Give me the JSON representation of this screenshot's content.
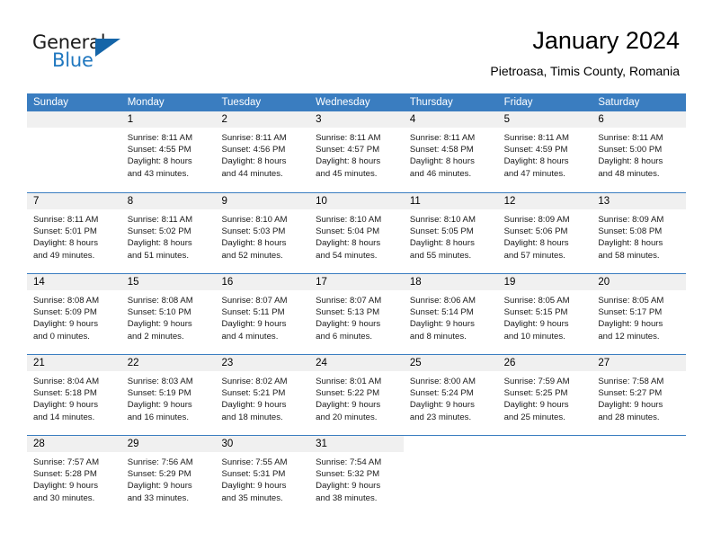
{
  "brand": {
    "name_part1": "General",
    "name_part2": "Blue"
  },
  "header": {
    "month_title": "January 2024",
    "location": "Pietroasa, Timis County, Romania"
  },
  "colors": {
    "header_bar": "#3a7dc0",
    "day_number_bg": "#f0f0f0",
    "brand_blue": "#1f77bf",
    "triangle_blue": "#1565a8"
  },
  "weekdays": [
    "Sunday",
    "Monday",
    "Tuesday",
    "Wednesday",
    "Thursday",
    "Friday",
    "Saturday"
  ],
  "weeks": [
    [
      {
        "day": "",
        "sunrise": "",
        "sunset": "",
        "daylight1": "",
        "daylight2": "",
        "empty": true
      },
      {
        "day": "1",
        "sunrise": "Sunrise: 8:11 AM",
        "sunset": "Sunset: 4:55 PM",
        "daylight1": "Daylight: 8 hours",
        "daylight2": "and 43 minutes."
      },
      {
        "day": "2",
        "sunrise": "Sunrise: 8:11 AM",
        "sunset": "Sunset: 4:56 PM",
        "daylight1": "Daylight: 8 hours",
        "daylight2": "and 44 minutes."
      },
      {
        "day": "3",
        "sunrise": "Sunrise: 8:11 AM",
        "sunset": "Sunset: 4:57 PM",
        "daylight1": "Daylight: 8 hours",
        "daylight2": "and 45 minutes."
      },
      {
        "day": "4",
        "sunrise": "Sunrise: 8:11 AM",
        "sunset": "Sunset: 4:58 PM",
        "daylight1": "Daylight: 8 hours",
        "daylight2": "and 46 minutes."
      },
      {
        "day": "5",
        "sunrise": "Sunrise: 8:11 AM",
        "sunset": "Sunset: 4:59 PM",
        "daylight1": "Daylight: 8 hours",
        "daylight2": "and 47 minutes."
      },
      {
        "day": "6",
        "sunrise": "Sunrise: 8:11 AM",
        "sunset": "Sunset: 5:00 PM",
        "daylight1": "Daylight: 8 hours",
        "daylight2": "and 48 minutes."
      }
    ],
    [
      {
        "day": "7",
        "sunrise": "Sunrise: 8:11 AM",
        "sunset": "Sunset: 5:01 PM",
        "daylight1": "Daylight: 8 hours",
        "daylight2": "and 49 minutes."
      },
      {
        "day": "8",
        "sunrise": "Sunrise: 8:11 AM",
        "sunset": "Sunset: 5:02 PM",
        "daylight1": "Daylight: 8 hours",
        "daylight2": "and 51 minutes."
      },
      {
        "day": "9",
        "sunrise": "Sunrise: 8:10 AM",
        "sunset": "Sunset: 5:03 PM",
        "daylight1": "Daylight: 8 hours",
        "daylight2": "and 52 minutes."
      },
      {
        "day": "10",
        "sunrise": "Sunrise: 8:10 AM",
        "sunset": "Sunset: 5:04 PM",
        "daylight1": "Daylight: 8 hours",
        "daylight2": "and 54 minutes."
      },
      {
        "day": "11",
        "sunrise": "Sunrise: 8:10 AM",
        "sunset": "Sunset: 5:05 PM",
        "daylight1": "Daylight: 8 hours",
        "daylight2": "and 55 minutes."
      },
      {
        "day": "12",
        "sunrise": "Sunrise: 8:09 AM",
        "sunset": "Sunset: 5:06 PM",
        "daylight1": "Daylight: 8 hours",
        "daylight2": "and 57 minutes."
      },
      {
        "day": "13",
        "sunrise": "Sunrise: 8:09 AM",
        "sunset": "Sunset: 5:08 PM",
        "daylight1": "Daylight: 8 hours",
        "daylight2": "and 58 minutes."
      }
    ],
    [
      {
        "day": "14",
        "sunrise": "Sunrise: 8:08 AM",
        "sunset": "Sunset: 5:09 PM",
        "daylight1": "Daylight: 9 hours",
        "daylight2": "and 0 minutes."
      },
      {
        "day": "15",
        "sunrise": "Sunrise: 8:08 AM",
        "sunset": "Sunset: 5:10 PM",
        "daylight1": "Daylight: 9 hours",
        "daylight2": "and 2 minutes."
      },
      {
        "day": "16",
        "sunrise": "Sunrise: 8:07 AM",
        "sunset": "Sunset: 5:11 PM",
        "daylight1": "Daylight: 9 hours",
        "daylight2": "and 4 minutes."
      },
      {
        "day": "17",
        "sunrise": "Sunrise: 8:07 AM",
        "sunset": "Sunset: 5:13 PM",
        "daylight1": "Daylight: 9 hours",
        "daylight2": "and 6 minutes."
      },
      {
        "day": "18",
        "sunrise": "Sunrise: 8:06 AM",
        "sunset": "Sunset: 5:14 PM",
        "daylight1": "Daylight: 9 hours",
        "daylight2": "and 8 minutes."
      },
      {
        "day": "19",
        "sunrise": "Sunrise: 8:05 AM",
        "sunset": "Sunset: 5:15 PM",
        "daylight1": "Daylight: 9 hours",
        "daylight2": "and 10 minutes."
      },
      {
        "day": "20",
        "sunrise": "Sunrise: 8:05 AM",
        "sunset": "Sunset: 5:17 PM",
        "daylight1": "Daylight: 9 hours",
        "daylight2": "and 12 minutes."
      }
    ],
    [
      {
        "day": "21",
        "sunrise": "Sunrise: 8:04 AM",
        "sunset": "Sunset: 5:18 PM",
        "daylight1": "Daylight: 9 hours",
        "daylight2": "and 14 minutes."
      },
      {
        "day": "22",
        "sunrise": "Sunrise: 8:03 AM",
        "sunset": "Sunset: 5:19 PM",
        "daylight1": "Daylight: 9 hours",
        "daylight2": "and 16 minutes."
      },
      {
        "day": "23",
        "sunrise": "Sunrise: 8:02 AM",
        "sunset": "Sunset: 5:21 PM",
        "daylight1": "Daylight: 9 hours",
        "daylight2": "and 18 minutes."
      },
      {
        "day": "24",
        "sunrise": "Sunrise: 8:01 AM",
        "sunset": "Sunset: 5:22 PM",
        "daylight1": "Daylight: 9 hours",
        "daylight2": "and 20 minutes."
      },
      {
        "day": "25",
        "sunrise": "Sunrise: 8:00 AM",
        "sunset": "Sunset: 5:24 PM",
        "daylight1": "Daylight: 9 hours",
        "daylight2": "and 23 minutes."
      },
      {
        "day": "26",
        "sunrise": "Sunrise: 7:59 AM",
        "sunset": "Sunset: 5:25 PM",
        "daylight1": "Daylight: 9 hours",
        "daylight2": "and 25 minutes."
      },
      {
        "day": "27",
        "sunrise": "Sunrise: 7:58 AM",
        "sunset": "Sunset: 5:27 PM",
        "daylight1": "Daylight: 9 hours",
        "daylight2": "and 28 minutes."
      }
    ],
    [
      {
        "day": "28",
        "sunrise": "Sunrise: 7:57 AM",
        "sunset": "Sunset: 5:28 PM",
        "daylight1": "Daylight: 9 hours",
        "daylight2": "and 30 minutes."
      },
      {
        "day": "29",
        "sunrise": "Sunrise: 7:56 AM",
        "sunset": "Sunset: 5:29 PM",
        "daylight1": "Daylight: 9 hours",
        "daylight2": "and 33 minutes."
      },
      {
        "day": "30",
        "sunrise": "Sunrise: 7:55 AM",
        "sunset": "Sunset: 5:31 PM",
        "daylight1": "Daylight: 9 hours",
        "daylight2": "and 35 minutes."
      },
      {
        "day": "31",
        "sunrise": "Sunrise: 7:54 AM",
        "sunset": "Sunset: 5:32 PM",
        "daylight1": "Daylight: 9 hours",
        "daylight2": "and 38 minutes."
      },
      {
        "day": "",
        "sunrise": "",
        "sunset": "",
        "daylight1": "",
        "daylight2": "",
        "empty": true,
        "blank": true
      },
      {
        "day": "",
        "sunrise": "",
        "sunset": "",
        "daylight1": "",
        "daylight2": "",
        "empty": true,
        "blank": true
      },
      {
        "day": "",
        "sunrise": "",
        "sunset": "",
        "daylight1": "",
        "daylight2": "",
        "empty": true,
        "blank": true
      }
    ]
  ]
}
